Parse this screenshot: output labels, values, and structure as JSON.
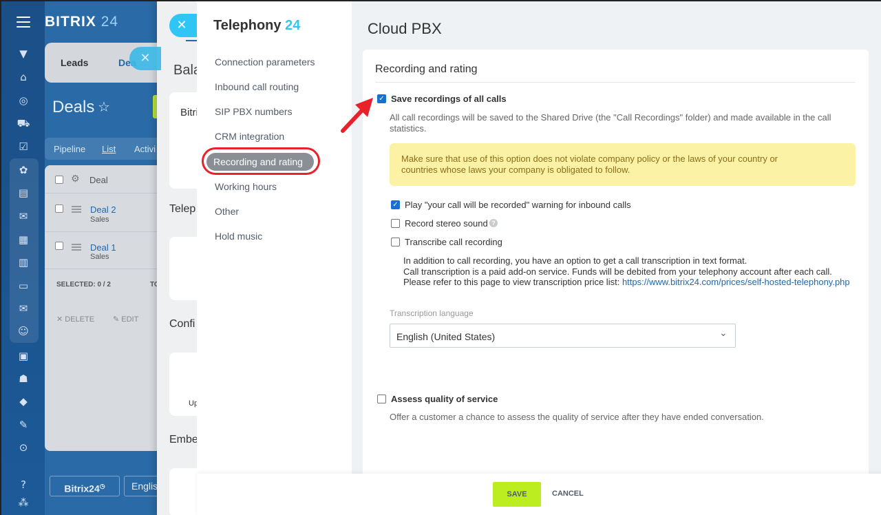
{
  "crm": {
    "brand_name": "BITRIX",
    "brand_num": "24",
    "tabs": [
      "Leads",
      "Dea"
    ],
    "deals_title": "Deals",
    "filters": [
      "Pipeline",
      "List",
      "Activi"
    ],
    "list_header": "Deal",
    "rows": [
      {
        "name": "Deal 2",
        "sub": "Sales"
      },
      {
        "name": "Deal 1",
        "sub": "Sales"
      }
    ],
    "selected": "SELECTED: 0 / 2",
    "to": "TO",
    "delete": "DELETE",
    "edit": "EDIT",
    "footer_brand": "Bitrix24",
    "footer_lang": "English"
  },
  "middle": {
    "t1": "Bala",
    "t2": "Bitri",
    "t3": "Telep",
    "t4": "Confi",
    "t5": "Up",
    "t6": "Embe"
  },
  "telephony": {
    "title": "Telephony",
    "title_num": "24",
    "menu": [
      "Connection parameters",
      "Inbound call routing",
      "SIP PBX numbers",
      "CRM integration",
      "Recording and rating",
      "Working hours",
      "Other",
      "Hold music"
    ]
  },
  "page": {
    "title": "Cloud PBX",
    "section_title": "Recording and rating",
    "save_all_label": "Save recordings of all calls",
    "save_all_checked": true,
    "save_all_desc": "All call recordings will be saved to the Shared Drive (the \"Call Recordings\" folder) and made available in the call statistics.",
    "warning": "Make sure that use of this option does not violate company policy or the laws of your country or countries whose laws your company is obligated to follow.",
    "play_warning_label": "Play \"your call will be recorded\" warning for inbound calls",
    "play_warning_checked": true,
    "stereo_label": "Record stereo sound",
    "stereo_checked": false,
    "transcribe_label": "Transcribe call recording",
    "transcribe_checked": false,
    "transcribe_desc_1": "In addition to call recording, you have an option to get a call transcription in text format.",
    "transcribe_desc_2": "Call transcription is a paid add-on service. Funds will be debited from your telephony account after each call.",
    "transcribe_desc_3": "Please refer to this page to view transcription price list:",
    "transcribe_link": "https://www.bitrix24.com/prices/self-hosted-telephony.php",
    "lang_label": "Transcription language",
    "lang_value": "English (United States)",
    "quality_label": "Assess quality of service",
    "quality_checked": false,
    "quality_desc": "Offer a customer a chance to assess the quality of service after they have ended conversation."
  },
  "footer": {
    "save": "SAVE",
    "cancel": "CANCEL"
  },
  "colors": {
    "accent": "#2fc6f6",
    "save_button": "#bbed21",
    "highlight_ring": "#e8212b",
    "warning_bg": "#fbf2a5"
  },
  "icons": [
    "menu-icon",
    "close-icon",
    "star-icon",
    "gear-icon",
    "help-icon",
    "chevron-down-icon",
    "checkmark-icon",
    "annotation-arrow"
  ]
}
